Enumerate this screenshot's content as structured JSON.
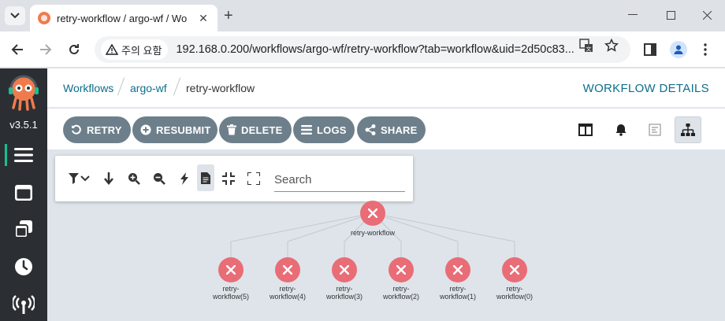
{
  "browser": {
    "tab_title": "retry-workflow / argo-wf / Wo",
    "security_label": "주의 요함",
    "url": "192.168.0.200/workflows/argo-wf/retry-workflow?tab=workflow&uid=2d50c83..."
  },
  "sidebar": {
    "version": "v3.5.1",
    "items": [
      {
        "icon": "menu-icon"
      },
      {
        "icon": "workflow-templates-icon"
      },
      {
        "icon": "cluster-templates-icon"
      },
      {
        "icon": "cron-clock-icon"
      },
      {
        "icon": "event-sources-icon"
      }
    ]
  },
  "breadcrumb": {
    "items": [
      "Workflows",
      "argo-wf",
      "retry-workflow"
    ]
  },
  "page_title": "WORKFLOW DETAILS",
  "actions": [
    "RETRY",
    "RESUBMIT",
    "DELETE",
    "LOGS",
    "SHARE"
  ],
  "graph": {
    "search_placeholder": "Search",
    "root": {
      "label": "retry-workflow",
      "status": "failed"
    },
    "children": [
      {
        "label1": "retry-",
        "label2": "workflow(5)",
        "status": "failed"
      },
      {
        "label1": "retry-",
        "label2": "workflow(4)",
        "status": "failed"
      },
      {
        "label1": "retry-",
        "label2": "workflow(3)",
        "status": "failed"
      },
      {
        "label1": "retry-",
        "label2": "workflow(2)",
        "status": "failed"
      },
      {
        "label1": "retry-",
        "label2": "workflow(1)",
        "status": "failed"
      },
      {
        "label1": "retry-",
        "label2": "workflow(0)",
        "status": "failed"
      }
    ]
  },
  "colors": {
    "sidebar_bg": "#2b2f33",
    "accent": "#18be94",
    "link": "#0d6e8b",
    "button_bg": "#6d7f8b",
    "failed_node": "#e96d76"
  }
}
